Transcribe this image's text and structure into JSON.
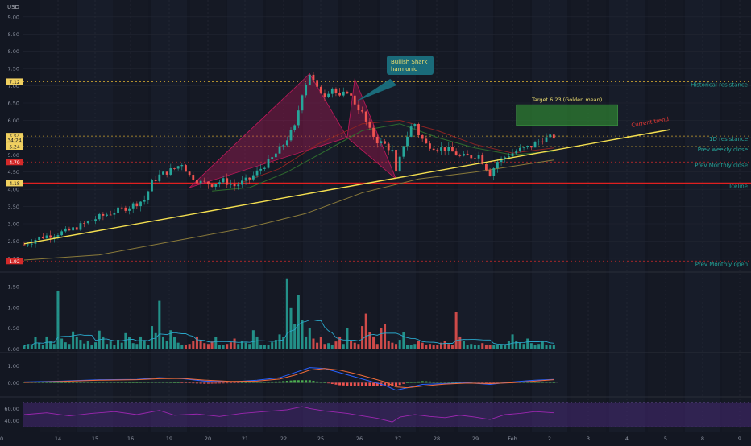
{
  "currency": "USD",
  "chart_data": [
    {
      "type": "candlestick",
      "panel": "price",
      "title": "",
      "ylabel": "USD",
      "ylim": [
        1.6,
        9.3
      ],
      "y_ticks": [
        "9.00",
        "8.50",
        "8.00",
        "7.50",
        "7.00",
        "6.50",
        "6.00",
        "5.50",
        "5.00",
        "4.50",
        "4.00",
        "3.50",
        "3.00",
        "2.50",
        "2.00"
      ],
      "x_ticks": [
        "14",
        "15",
        "16",
        "19",
        "20",
        "21",
        "22",
        "25",
        "26",
        "27",
        "28",
        "29",
        "Feb",
        "2",
        "3",
        "4",
        "5",
        "8",
        "9",
        "10"
      ],
      "price_badges": [
        {
          "label": "7.12",
          "value": 7.12,
          "color": "#f0d060",
          "text_color": "#131722"
        },
        {
          "label": "5.54",
          "value": 5.54,
          "color": "#f0d060",
          "text_color": "#131722"
        },
        {
          "label": "5.43",
          "value": 5.43,
          "color": "#f0d060",
          "text_color": "#131722"
        },
        {
          "label": "5.24",
          "value": 5.24,
          "color": "#f0d060",
          "text_color": "#131722"
        },
        {
          "label": "4.79",
          "value": 4.79,
          "color": "#d42a2a",
          "text_color": "#ffffff"
        },
        {
          "label": "4.18",
          "value": 4.18,
          "color": "#f0d060",
          "text_color": "#131722"
        },
        {
          "label": "1.92",
          "value": 1.92,
          "color": "#d42a2a",
          "text_color": "#ffffff"
        }
      ],
      "countdown": "34:24",
      "levels": [
        {
          "name": "Historical resistance",
          "value": 7.12,
          "color": "#c8a030",
          "label_color": "#26a69a"
        },
        {
          "name": "1D resistance",
          "value": 5.54,
          "color": "#c8a030",
          "label_color": "#26a69a"
        },
        {
          "name": "Prev weekly close",
          "value": 5.24,
          "color": "#c8a030",
          "label_color": "#26a69a"
        },
        {
          "name": "Prev Monthly close",
          "value": 4.79,
          "color": "#d42a2a",
          "label_color": "#26a69a"
        },
        {
          "name": "Iceline",
          "value": 4.18,
          "color": "#e02020",
          "label_color": "#26a69a"
        },
        {
          "name": "Prev Monthly open",
          "value": 1.92,
          "color": "#d42a2a",
          "label_color": "#26a69a"
        }
      ],
      "trendline": {
        "label": "Current trend",
        "start": [
          0,
          2.42
        ],
        "end": [
          172,
          5.73
        ],
        "color": "#f5e050"
      },
      "target_box": {
        "label": "Target 6.23 (Golden mean)",
        "x_range": [
          131,
          158
        ],
        "y_range": [
          5.85,
          6.45
        ],
        "color": "#2e7d32"
      },
      "callout": {
        "line1": "Bullish Shark",
        "line2": "harmonic",
        "bg": "#1a6b7a",
        "text_color": "#f0e070"
      },
      "pattern_color": "#c2185b",
      "up_color": "#26a69a",
      "down_color": "#ef5350",
      "close_path": [
        [
          0,
          2.4
        ],
        [
          4,
          2.6
        ],
        [
          8,
          2.7
        ],
        [
          12,
          2.8
        ],
        [
          16,
          3.0
        ],
        [
          20,
          3.2
        ],
        [
          24,
          3.35
        ],
        [
          28,
          3.5
        ],
        [
          32,
          3.7
        ],
        [
          34,
          4.2
        ],
        [
          36,
          4.4
        ],
        [
          40,
          4.6
        ],
        [
          42,
          4.75
        ],
        [
          44,
          4.4
        ],
        [
          47,
          4.2
        ],
        [
          50,
          4.15
        ],
        [
          53,
          4.25
        ],
        [
          56,
          4.1
        ],
        [
          60,
          4.3
        ],
        [
          63,
          4.6
        ],
        [
          66,
          4.9
        ],
        [
          69,
          5.3
        ],
        [
          72,
          5.8
        ],
        [
          74,
          6.8
        ],
        [
          76,
          7.35
        ],
        [
          78,
          6.9
        ],
        [
          80,
          6.75
        ],
        [
          82,
          6.95
        ],
        [
          84,
          6.65
        ],
        [
          86,
          6.85
        ],
        [
          88,
          6.5
        ],
        [
          90,
          6.2
        ],
        [
          92,
          5.7
        ],
        [
          94,
          5.4
        ],
        [
          96,
          5.3
        ],
        [
          98,
          5.1
        ],
        [
          99,
          4.45
        ],
        [
          101,
          5.3
        ],
        [
          103,
          5.8
        ],
        [
          104,
          5.9
        ],
        [
          105,
          5.6
        ],
        [
          107,
          5.3
        ],
        [
          110,
          5.2
        ],
        [
          113,
          5.15
        ],
        [
          116,
          4.95
        ],
        [
          119,
          4.95
        ],
        [
          121,
          5.0
        ],
        [
          122,
          4.8
        ],
        [
          124,
          4.45
        ],
        [
          126,
          4.8
        ],
        [
          129,
          5.0
        ],
        [
          132,
          5.15
        ],
        [
          135,
          5.25
        ],
        [
          138,
          5.45
        ],
        [
          140,
          5.5
        ],
        [
          141,
          5.52
        ]
      ],
      "moving_averages": [
        {
          "color": "#8b2323",
          "points": [
            [
              58,
              4.2
            ],
            [
              68,
              4.6
            ],
            [
              78,
              5.3
            ],
            [
              90,
              5.9
            ],
            [
              100,
              6.0
            ],
            [
              110,
              5.7
            ],
            [
              120,
              5.3
            ],
            [
              130,
              5.05
            ],
            [
              141,
              5.2
            ]
          ]
        },
        {
          "color": "#2e6b2e",
          "points": [
            [
              50,
              3.95
            ],
            [
              60,
              4.05
            ],
            [
              70,
              4.5
            ],
            [
              80,
              5.1
            ],
            [
              90,
              5.7
            ],
            [
              100,
              5.9
            ],
            [
              110,
              5.5
            ],
            [
              120,
              5.2
            ],
            [
              130,
              5.0
            ],
            [
              141,
              5.1
            ]
          ]
        },
        {
          "color": "#8a7a3a",
          "points": [
            [
              0,
              1.95
            ],
            [
              20,
              2.1
            ],
            [
              40,
              2.5
            ],
            [
              60,
              2.9
            ],
            [
              75,
              3.3
            ],
            [
              90,
              3.9
            ],
            [
              105,
              4.3
            ],
            [
              120,
              4.5
            ],
            [
              141,
              4.85
            ]
          ]
        }
      ]
    },
    {
      "type": "bar",
      "panel": "volume",
      "y_ticks": [
        "1.50",
        "1.00",
        "0.50",
        "0.00"
      ],
      "ylim": [
        -0.05,
        1.85
      ],
      "values": [
        0.08,
        0.12,
        0.1,
        0.28,
        0.15,
        0.1,
        0.3,
        0.18,
        0.12,
        1.4,
        0.25,
        0.16,
        0.12,
        0.42,
        0.3,
        0.22,
        0.13,
        0.2,
        0.1,
        0.16,
        0.44,
        0.3,
        0.12,
        0.18,
        0.1,
        0.22,
        0.15,
        0.38,
        0.28,
        0.14,
        0.12,
        0.3,
        0.2,
        0.1,
        0.55,
        0.38,
        1.16,
        0.3,
        0.2,
        0.45,
        0.28,
        0.15,
        0.1,
        0.1,
        0.12,
        0.2,
        0.3,
        0.22,
        0.14,
        0.12,
        0.18,
        0.28,
        0.1,
        0.1,
        0.12,
        0.16,
        0.25,
        0.12,
        0.2,
        0.15,
        0.12,
        0.45,
        0.3,
        0.1,
        0.1,
        0.1,
        0.16,
        0.22,
        0.35,
        0.28,
        1.7,
        1.0,
        0.6,
        1.3,
        0.7,
        0.3,
        0.5,
        0.25,
        0.15,
        0.3,
        0.12,
        0.14,
        0.1,
        0.18,
        0.3,
        0.12,
        0.5,
        0.2,
        0.15,
        0.12,
        0.55,
        0.85,
        0.4,
        0.3,
        0.12,
        0.5,
        0.6,
        0.2,
        0.15,
        0.12,
        0.22,
        0.4,
        0.1,
        0.1,
        0.12,
        0.2,
        0.15,
        0.1,
        0.12,
        0.1,
        0.1,
        0.15,
        0.2,
        0.12,
        0.1,
        0.9,
        0.3,
        0.2,
        0.1,
        0.12,
        0.1,
        0.1,
        0.14,
        0.1,
        0.1,
        0.1,
        0.1,
        0.12,
        0.1,
        0.2,
        0.35,
        0.2,
        0.15,
        0.12,
        0.25,
        0.14,
        0.1,
        0.12,
        0.2,
        0.1,
        0.1,
        0.1
      ],
      "up_color": "#26a69a",
      "down_color": "#ef5350",
      "ma_color": "#2aa6c9"
    },
    {
      "type": "histogram",
      "panel": "macd",
      "y_ticks": [
        "1.00",
        "0.00"
      ],
      "ylim": [
        -0.7,
        1.7
      ],
      "up_color": "#4caf50",
      "down_color": "#ef5350",
      "macd_color": "#2962ff",
      "signal_color": "#ef6c3a",
      "macd_line": [
        [
          0,
          0.05
        ],
        [
          10,
          0.1
        ],
        [
          20,
          0.18
        ],
        [
          30,
          0.2
        ],
        [
          36,
          0.3
        ],
        [
          42,
          0.25
        ],
        [
          48,
          0.1
        ],
        [
          55,
          0.05
        ],
        [
          62,
          0.15
        ],
        [
          68,
          0.3
        ],
        [
          72,
          0.6
        ],
        [
          76,
          0.9
        ],
        [
          80,
          0.85
        ],
        [
          84,
          0.6
        ],
        [
          88,
          0.35
        ],
        [
          92,
          0.1
        ],
        [
          96,
          -0.15
        ],
        [
          99,
          -0.45
        ],
        [
          102,
          -0.3
        ],
        [
          106,
          -0.1
        ],
        [
          112,
          -0.05
        ],
        [
          118,
          0.0
        ],
        [
          124,
          -0.1
        ],
        [
          130,
          0.05
        ],
        [
          136,
          0.15
        ],
        [
          141,
          0.2
        ]
      ],
      "signal_line": [
        [
          0,
          0.02
        ],
        [
          10,
          0.08
        ],
        [
          20,
          0.15
        ],
        [
          30,
          0.18
        ],
        [
          36,
          0.24
        ],
        [
          42,
          0.26
        ],
        [
          48,
          0.16
        ],
        [
          55,
          0.08
        ],
        [
          62,
          0.1
        ],
        [
          68,
          0.22
        ],
        [
          72,
          0.45
        ],
        [
          76,
          0.75
        ],
        [
          80,
          0.85
        ],
        [
          84,
          0.75
        ],
        [
          88,
          0.55
        ],
        [
          92,
          0.3
        ],
        [
          96,
          0.05
        ],
        [
          99,
          -0.25
        ],
        [
          102,
          -0.3
        ],
        [
          106,
          -0.2
        ],
        [
          112,
          -0.08
        ],
        [
          118,
          -0.02
        ],
        [
          124,
          -0.05
        ],
        [
          130,
          0.0
        ],
        [
          136,
          0.1
        ],
        [
          141,
          0.18
        ]
      ]
    },
    {
      "type": "line",
      "panel": "rsi",
      "y_ticks": [
        "60.00",
        "40.00"
      ],
      "ylim": [
        25,
        75
      ],
      "band": [
        30,
        70
      ],
      "band_color": "#4a2a7a",
      "line_color": "#9c27b0",
      "values": [
        [
          0,
          50
        ],
        [
          6,
          53
        ],
        [
          12,
          48
        ],
        [
          18,
          52
        ],
        [
          24,
          55
        ],
        [
          30,
          50
        ],
        [
          36,
          57
        ],
        [
          40,
          49
        ],
        [
          46,
          51
        ],
        [
          52,
          47
        ],
        [
          58,
          52
        ],
        [
          64,
          55
        ],
        [
          70,
          58
        ],
        [
          74,
          63
        ],
        [
          76,
          60
        ],
        [
          80,
          56
        ],
        [
          86,
          52
        ],
        [
          90,
          48
        ],
        [
          94,
          44
        ],
        [
          98,
          38
        ],
        [
          100,
          46
        ],
        [
          104,
          50
        ],
        [
          108,
          47
        ],
        [
          112,
          45
        ],
        [
          116,
          49
        ],
        [
          120,
          46
        ],
        [
          124,
          42
        ],
        [
          128,
          50
        ],
        [
          132,
          52
        ],
        [
          136,
          55
        ],
        [
          141,
          53
        ]
      ]
    }
  ]
}
